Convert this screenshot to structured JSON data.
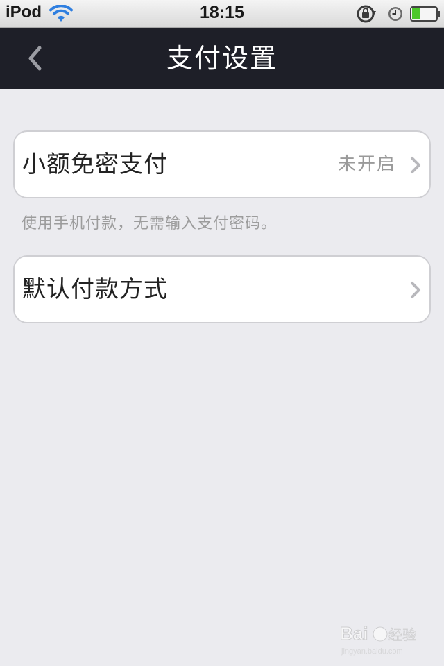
{
  "status_bar": {
    "device": "iPod",
    "time": "18:15",
    "icons": [
      "wifi-icon",
      "rotation-lock-icon",
      "alarm-icon",
      "battery-icon"
    ]
  },
  "nav": {
    "title": "支付设置",
    "back_icon": "chevron-left-icon"
  },
  "settings": {
    "small_amount_payment": {
      "label": "小额免密支付",
      "value": "未开启",
      "footer": "使用手机付款，无需输入支付密码。"
    },
    "default_payment_method": {
      "label": "默认付款方式",
      "value": ""
    }
  },
  "colors": {
    "nav_background": "#1e1f28",
    "page_background": "#ebebef",
    "cell_border": "#cfcfd3",
    "secondary_text": "#9a9a9a",
    "battery_green": "#4cc82a"
  },
  "watermark": {
    "logo": "Baidu经验",
    "url": "jingyan.baidu.com"
  }
}
